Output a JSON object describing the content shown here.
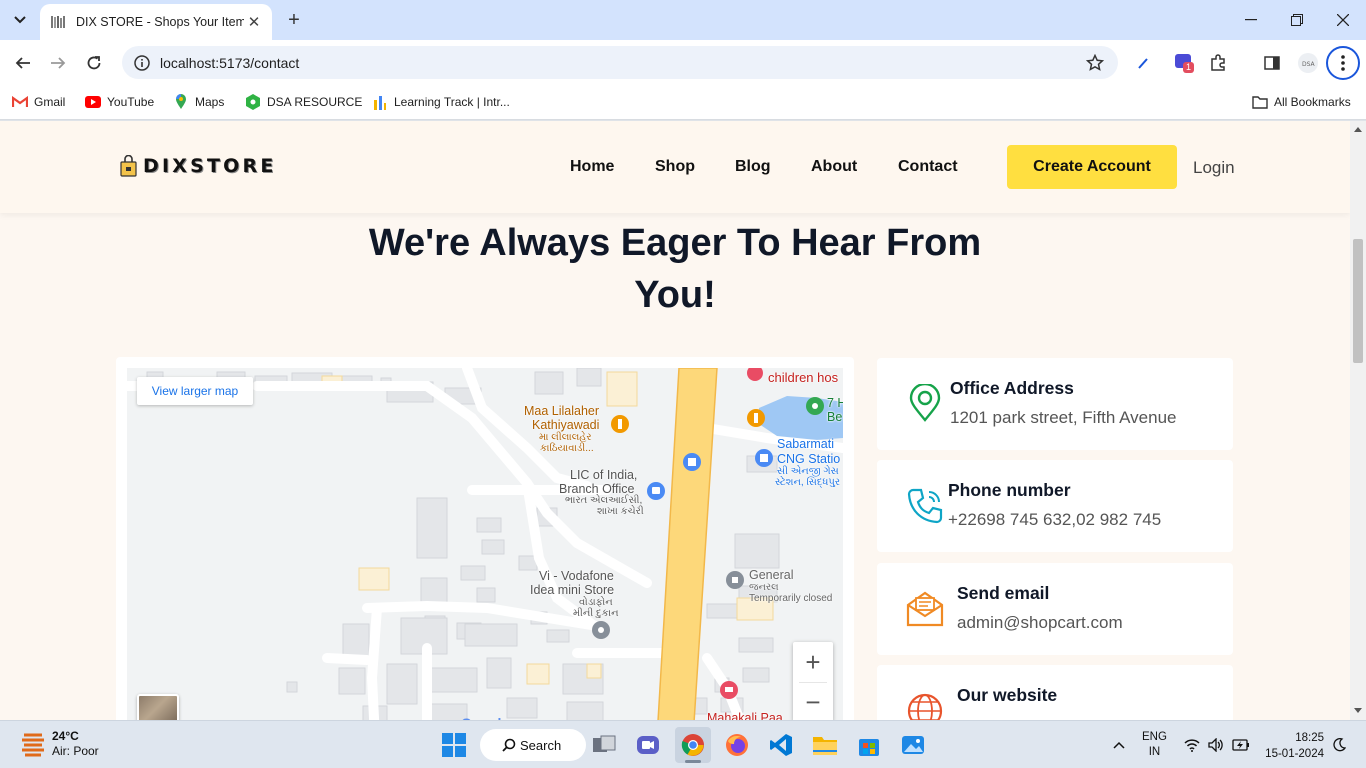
{
  "browser": {
    "tab_title": "DIX STORE - Shops Your Items",
    "url": "localhost:5173/contact",
    "bookmarks": [
      {
        "label": "Gmail",
        "icon": "gmail-icon"
      },
      {
        "label": "YouTube",
        "icon": "youtube-icon"
      },
      {
        "label": "Maps",
        "icon": "maps-icon"
      },
      {
        "label": "DSA RESOURCE",
        "icon": "dsa-icon"
      },
      {
        "label": "Learning Track | Intr...",
        "icon": "chart-icon"
      }
    ],
    "all_bookmarks": "All Bookmarks",
    "extension_badge": "1"
  },
  "site": {
    "logo_text": "DIXSTORE",
    "nav": [
      "Home",
      "Shop",
      "Blog",
      "About",
      "Contact"
    ],
    "create_account": "Create Account",
    "login": "Login",
    "heading_line1": "We're Always Eager To Hear From",
    "heading_line2": "You!"
  },
  "map": {
    "view_larger": "View larger map",
    "zoom_in": "+",
    "zoom_out": "−",
    "google": "Google",
    "labels": {
      "children": "children hos",
      "maa1": "Maa Lilalaher",
      "maa2": "Kathiyawadi",
      "maa3": "મા લીલાલહેર",
      "maa4": "કાઠિયાવાડી...",
      "sev1": "7 H",
      "sev2": "Be",
      "sab1": "Sabarmati",
      "sab2": "CNG Statio",
      "sab3": "સી એનજી ગેસ",
      "sab4": "સ્ટેશન, સિદ્ધપુર",
      "lic1": "LIC of India,",
      "lic2": "Branch Office",
      "lic3": "ભારત એલઆઈસી,",
      "lic4": "શાખા કચેરી",
      "gen1": "General",
      "gen2": "જનરલ",
      "gen3": "Temporarily closed",
      "vi1": "Vi - Vodafone",
      "vi2": "Idea mini Store",
      "vi3": "વોડાફોન",
      "vi4": "મીની દુકાન",
      "maha": "Mahakali Paa"
    }
  },
  "contact_cards": [
    {
      "title": "Office Address",
      "value": "1201 park street, Fifth Avenue",
      "icon": "location-pin-icon",
      "color": "#16a34a"
    },
    {
      "title": "Phone number",
      "value": "+22698 745 632,02 982 745",
      "icon": "phone-icon",
      "color": "#0ea5c6"
    },
    {
      "title": "Send email",
      "value": "admin@shopcart.com",
      "icon": "email-icon",
      "color": "#f08a24"
    },
    {
      "title": "Our website",
      "value": "",
      "icon": "globe-icon",
      "color": "#e8542c"
    }
  ],
  "taskbar": {
    "weather_temp": "24°C",
    "weather_text": "Air: Poor",
    "search": "Search",
    "lang1": "ENG",
    "lang2": "IN",
    "time": "18:25",
    "date": "15-01-2024"
  }
}
